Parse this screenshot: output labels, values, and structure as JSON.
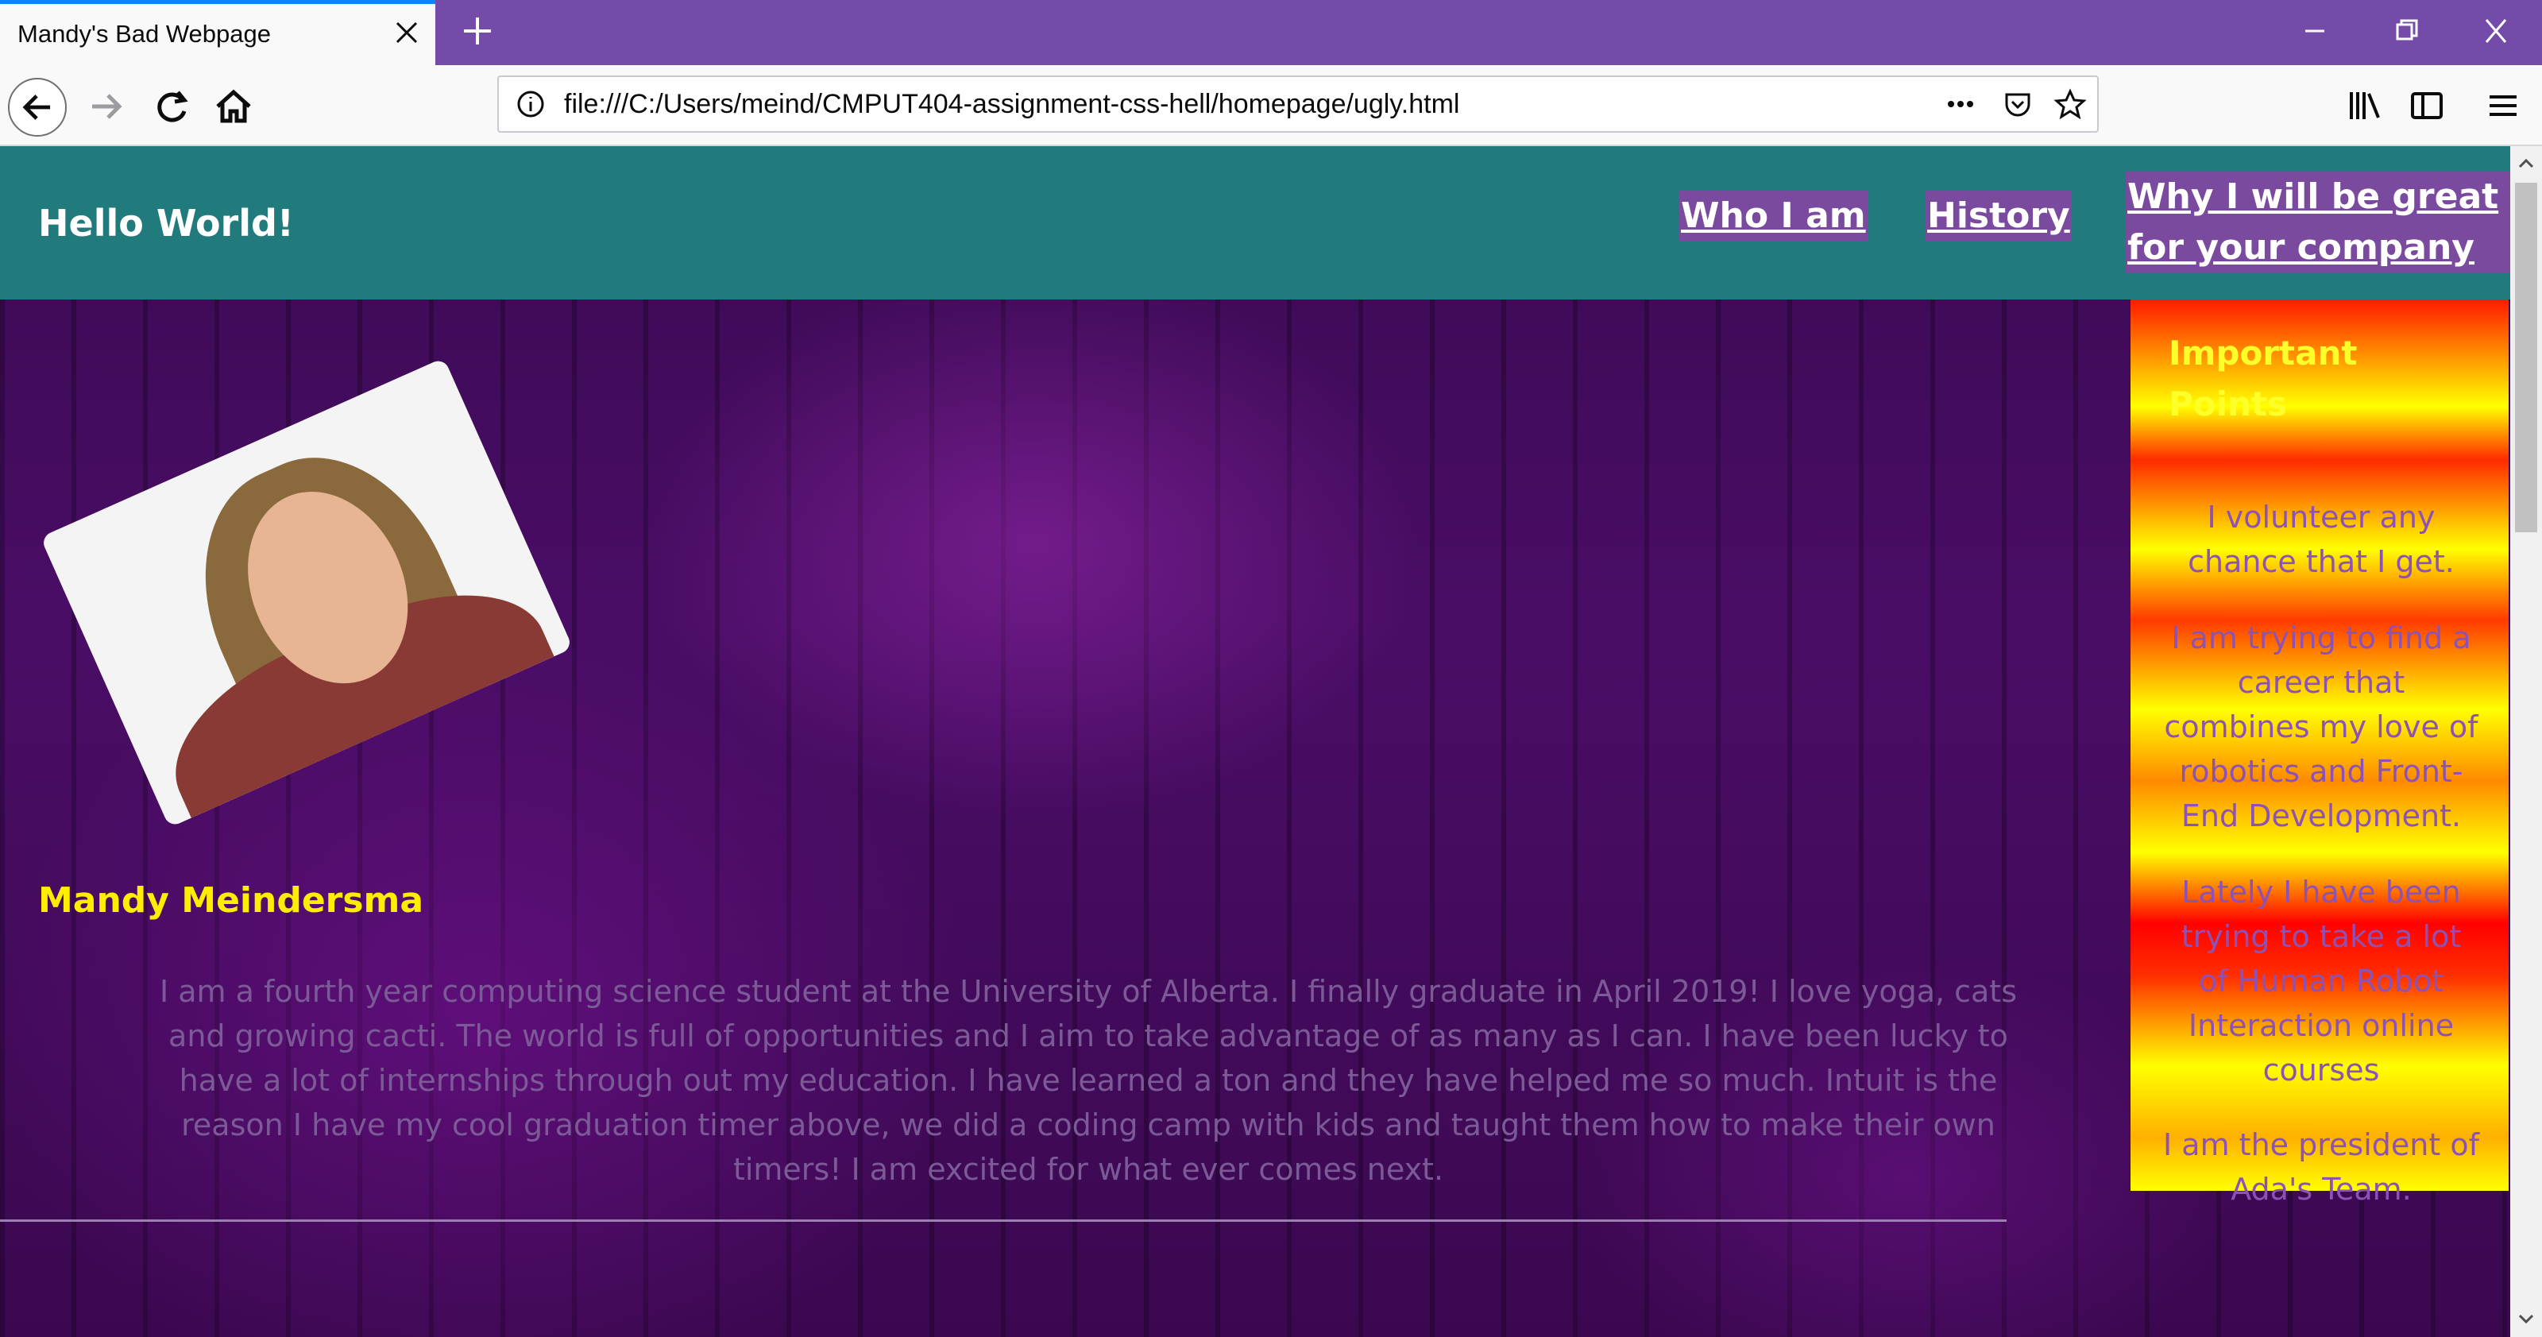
{
  "browser": {
    "tab_title": "Mandy's Bad Webpage",
    "url": "file:///C:/Users/meind/CMPUT404-assignment-css-hell/homepage/ugly.html",
    "url_actions": [
      "more-actions-icon",
      "pocket-icon",
      "bookmark-star-icon"
    ]
  },
  "site": {
    "title": "Hello World!",
    "nav": {
      "who": "Who I am",
      "history": "History",
      "why_line1": "Why I will be great",
      "why_line2": "for your company"
    }
  },
  "profile": {
    "name": "Mandy Meindersma",
    "bio": "I am a fourth year computing science student at the University of Alberta. I finally graduate in April 2019! I love yoga, cats and growing cacti. The world is full of opportunities and I aim to take advantage of as many as I can. I have been lucky to have a lot of internships through out my education. I have learned a ton and they have helped me so much. Intuit is the reason I have my cool graduation timer above, we did a coding camp with kids and taught them how to make their own timers! I am excited for what ever comes next."
  },
  "sidebar": {
    "title_line1": "Important",
    "title_line2": "Points",
    "points": [
      "I volunteer any chance that I get.",
      "I am trying to find a career that combines my love of robotics and Front-End Development.",
      "Lately I have been trying to take a lot of Human Robot Interaction online courses",
      "I am the president of Ada's Team."
    ]
  },
  "colors": {
    "titlebar": "#744ba8",
    "header": "#217b7c",
    "name": "#ffee00",
    "nav_bg": "#7a4a9e",
    "text_purple": "#8d52b5"
  }
}
